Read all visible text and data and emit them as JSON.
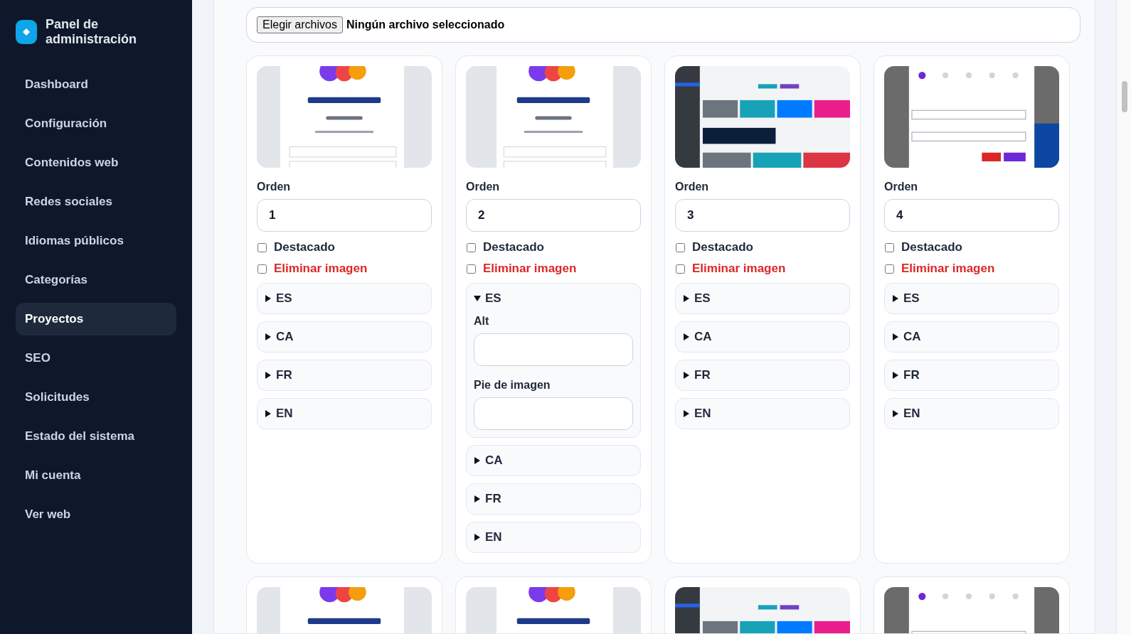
{
  "sidebar": {
    "title": "Panel de administración",
    "items": [
      {
        "label": "Dashboard",
        "selected": false
      },
      {
        "label": "Configuración",
        "selected": false
      },
      {
        "label": "Contenidos web",
        "selected": false
      },
      {
        "label": "Redes sociales",
        "selected": false
      },
      {
        "label": "Idiomas públicos",
        "selected": false
      },
      {
        "label": "Categorías",
        "selected": false
      },
      {
        "label": "Proyectos",
        "selected": true
      },
      {
        "label": "SEO",
        "selected": false
      },
      {
        "label": "Solicitudes",
        "selected": false
      },
      {
        "label": "Estado del sistema",
        "selected": false
      },
      {
        "label": "Mi cuenta",
        "selected": false
      },
      {
        "label": "Ver web",
        "selected": false
      }
    ]
  },
  "file_input": {
    "button": "Elegir archivos",
    "status": "Ningún archivo seleccionado"
  },
  "cards": [
    {
      "image": {
        "kind": "picture"
      },
      "order_label": "Orden",
      "order": "1",
      "featured": {
        "label": "Destacado",
        "checked": false
      },
      "delete": {
        "label": "Eliminar imagen",
        "checked": false
      },
      "languages": [
        {
          "code": "ES",
          "expanded": false
        },
        {
          "code": "CA",
          "expanded": false
        },
        {
          "code": "FR",
          "expanded": false
        },
        {
          "code": "EN",
          "expanded": false
        }
      ]
    },
    {
      "image": {
        "kind": "picture"
      },
      "order_label": "Orden",
      "order": "2",
      "featured": {
        "label": "Destacado",
        "checked": false
      },
      "delete": {
        "label": "Eliminar imagen",
        "checked": false
      },
      "languages": [
        {
          "code": "ES",
          "expanded": true,
          "fields": [
            {
              "label": "Alt"
            },
            {
              "label": "Pie de imagen"
            }
          ]
        },
        {
          "code": "CA",
          "expanded": false
        },
        {
          "code": "FR",
          "expanded": false
        },
        {
          "code": "EN",
          "expanded": false
        }
      ]
    },
    {
      "image": {
        "kind": "picture"
      },
      "order_label": "Orden",
      "order": "3",
      "featured": {
        "label": "Destacado",
        "checked": false
      },
      "delete": {
        "label": "Eliminar imagen",
        "checked": false
      },
      "languages": [
        {
          "code": "ES",
          "expanded": false
        },
        {
          "code": "CA",
          "expanded": false
        },
        {
          "code": "FR",
          "expanded": false
        },
        {
          "code": "EN",
          "expanded": false
        }
      ]
    },
    {
      "image": {
        "kind": "picture"
      },
      "order_label": "Orden",
      "order": "4",
      "featured": {
        "label": "Destacado",
        "checked": false
      },
      "delete": {
        "label": "Eliminar imagen",
        "checked": false
      },
      "languages": [
        {
          "code": "ES",
          "expanded": false
        },
        {
          "code": "CA",
          "expanded": false
        },
        {
          "code": "FR",
          "expanded": false
        },
        {
          "code": "EN",
          "expanded": false
        }
      ]
    },
    {
      "image": {
        "kind": "picture"
      }
    },
    {
      "image": {
        "kind": "picture"
      }
    },
    {
      "image": {
        "kind": "picture"
      }
    },
    {
      "image": {
        "kind": "picture"
      }
    }
  ]
}
